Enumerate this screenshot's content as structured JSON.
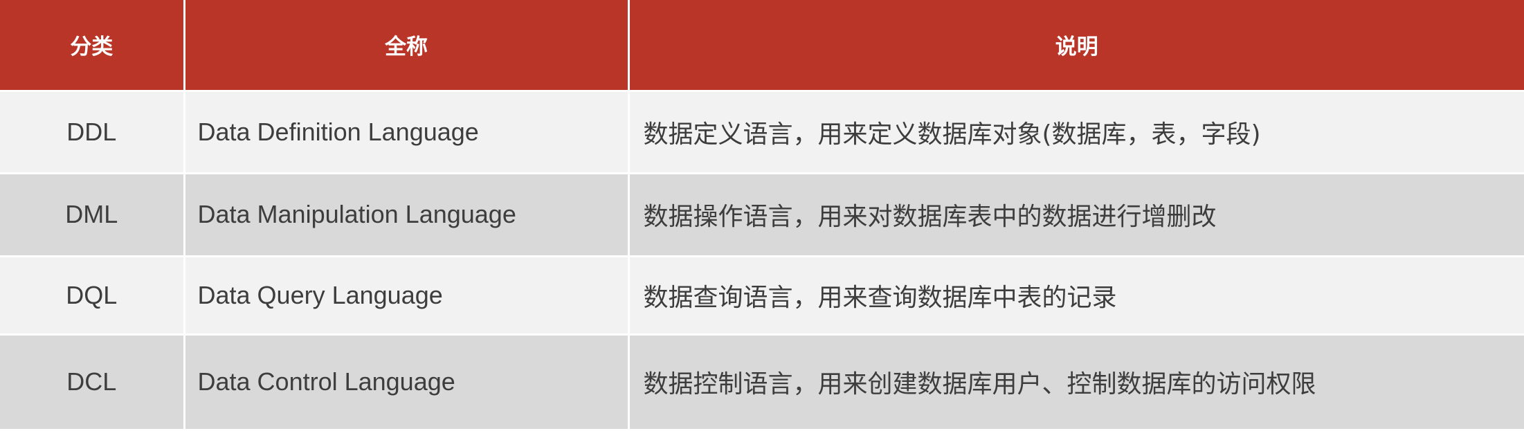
{
  "table": {
    "headers": {
      "category": "分类",
      "full_name": "全称",
      "description": "说明"
    },
    "rows": [
      {
        "category": "DDL",
        "full_name": "Data Definition Language",
        "description": "数据定义语言，用来定义数据库对象(数据库，表，字段)"
      },
      {
        "category": "DML",
        "full_name": "Data Manipulation Language",
        "description": "数据操作语言，用来对数据库表中的数据进行增删改"
      },
      {
        "category": "DQL",
        "full_name": "Data Query Language",
        "description": "数据查询语言，用来查询数据库中表的记录"
      },
      {
        "category": "DCL",
        "full_name": "Data Control Language",
        "description": "数据控制语言，用来创建数据库用户、控制数据库的访问权限"
      }
    ]
  },
  "colors": {
    "header_bg": "#b83527",
    "header_text": "#ffffff",
    "row_light": "#f2f2f2",
    "row_dark": "#d9d9d9",
    "body_text": "#3d3d3d"
  }
}
